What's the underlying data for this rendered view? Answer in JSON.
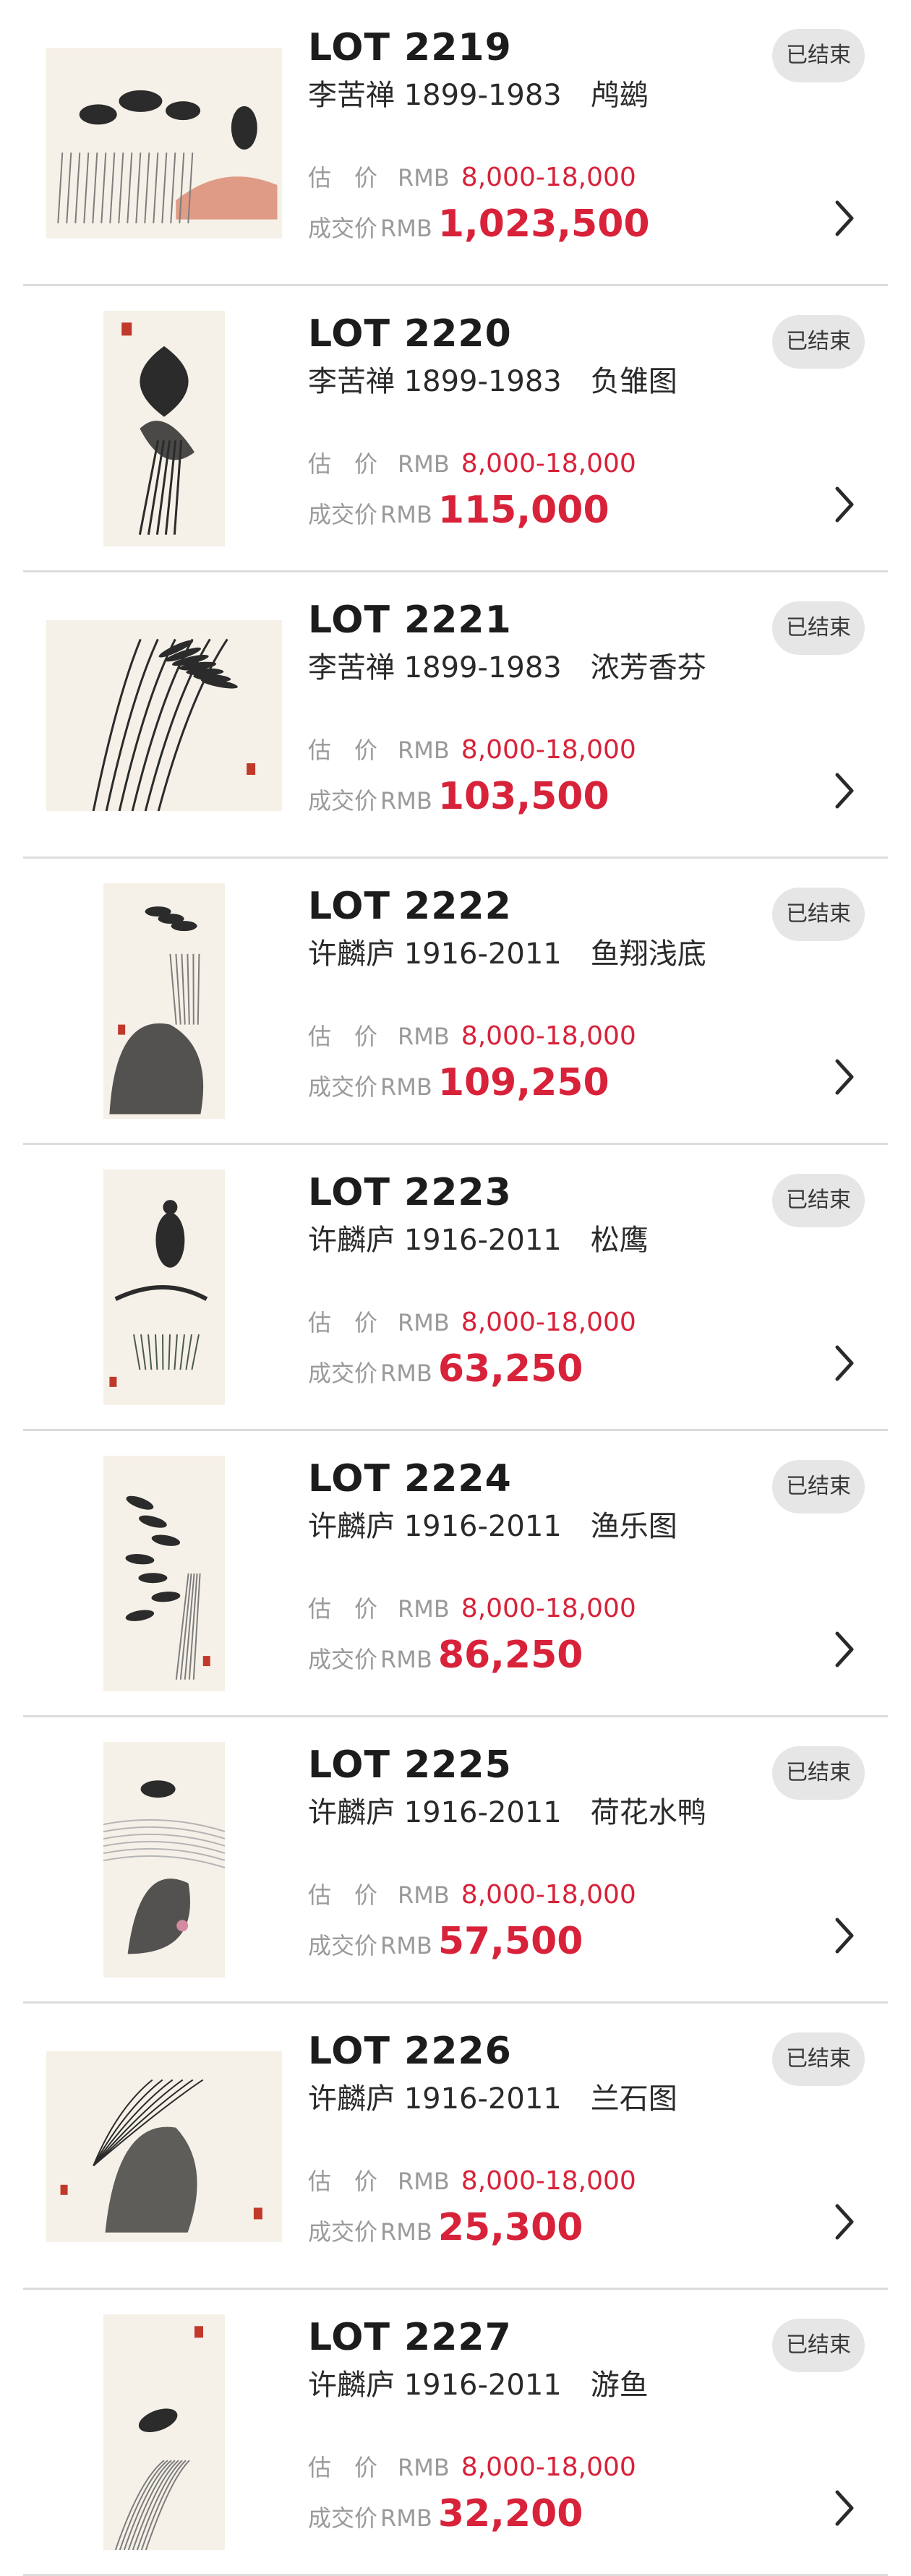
{
  "lots": [
    {
      "lot_number": "LOT 2219",
      "artist": "李苦禅 1899-1983",
      "title": "鸬鹚",
      "status": "已结束",
      "estimate_label": "估价",
      "estimate_currency": "RMB",
      "estimate": "8,000-18,000",
      "sold_label": "成交价",
      "sold_currency": "RMB",
      "sold_price": "1,023,500",
      "thumb_orientation": "landscape"
    },
    {
      "lot_number": "LOT 2220",
      "artist": "李苦禅 1899-1983",
      "title": "负雏图",
      "status": "已结束",
      "estimate_label": "估价",
      "estimate_currency": "RMB",
      "estimate": "8,000-18,000",
      "sold_label": "成交价",
      "sold_currency": "RMB",
      "sold_price": "115,000",
      "thumb_orientation": "portrait"
    },
    {
      "lot_number": "LOT 2221",
      "artist": "李苦禅 1899-1983",
      "title": "浓芳香芬",
      "status": "已结束",
      "estimate_label": "估价",
      "estimate_currency": "RMB",
      "estimate": "8,000-18,000",
      "sold_label": "成交价",
      "sold_currency": "RMB",
      "sold_price": "103,500",
      "thumb_orientation": "landscape"
    },
    {
      "lot_number": "LOT 2222",
      "artist": "许麟庐 1916-2011",
      "title": "鱼翔浅底",
      "status": "已结束",
      "estimate_label": "估价",
      "estimate_currency": "RMB",
      "estimate": "8,000-18,000",
      "sold_label": "成交价",
      "sold_currency": "RMB",
      "sold_price": "109,250",
      "thumb_orientation": "portrait"
    },
    {
      "lot_number": "LOT 2223",
      "artist": "许麟庐 1916-2011",
      "title": "松鹰",
      "status": "已结束",
      "estimate_label": "估价",
      "estimate_currency": "RMB",
      "estimate": "8,000-18,000",
      "sold_label": "成交价",
      "sold_currency": "RMB",
      "sold_price": "63,250",
      "thumb_orientation": "portrait"
    },
    {
      "lot_number": "LOT 2224",
      "artist": "许麟庐 1916-2011",
      "title": "渔乐图",
      "status": "已结束",
      "estimate_label": "估价",
      "estimate_currency": "RMB",
      "estimate": "8,000-18,000",
      "sold_label": "成交价",
      "sold_currency": "RMB",
      "sold_price": "86,250",
      "thumb_orientation": "portrait"
    },
    {
      "lot_number": "LOT 2225",
      "artist": "许麟庐 1916-2011",
      "title": "荷花水鸭",
      "status": "已结束",
      "estimate_label": "估价",
      "estimate_currency": "RMB",
      "estimate": "8,000-18,000",
      "sold_label": "成交价",
      "sold_currency": "RMB",
      "sold_price": "57,500",
      "thumb_orientation": "portrait"
    },
    {
      "lot_number": "LOT 2226",
      "artist": "许麟庐 1916-2011",
      "title": "兰石图",
      "status": "已结束",
      "estimate_label": "估价",
      "estimate_currency": "RMB",
      "estimate": "8,000-18,000",
      "sold_label": "成交价",
      "sold_currency": "RMB",
      "sold_price": "25,300",
      "thumb_orientation": "landscape"
    },
    {
      "lot_number": "LOT 2227",
      "artist": "许麟庐 1916-2011",
      "title": "游鱼",
      "status": "已结束",
      "estimate_label": "估价",
      "estimate_currency": "RMB",
      "estimate": "8,000-18,000",
      "sold_label": "成交价",
      "sold_currency": "RMB",
      "sold_price": "32,200",
      "thumb_orientation": "portrait"
    }
  ],
  "colors": {
    "accent_red": "#d8223a",
    "badge_bg": "#e6e6e6",
    "muted_text": "#9a9a9a",
    "divider": "#dcdcdc"
  },
  "icons": {
    "row_arrow": "chevron-right-icon"
  }
}
